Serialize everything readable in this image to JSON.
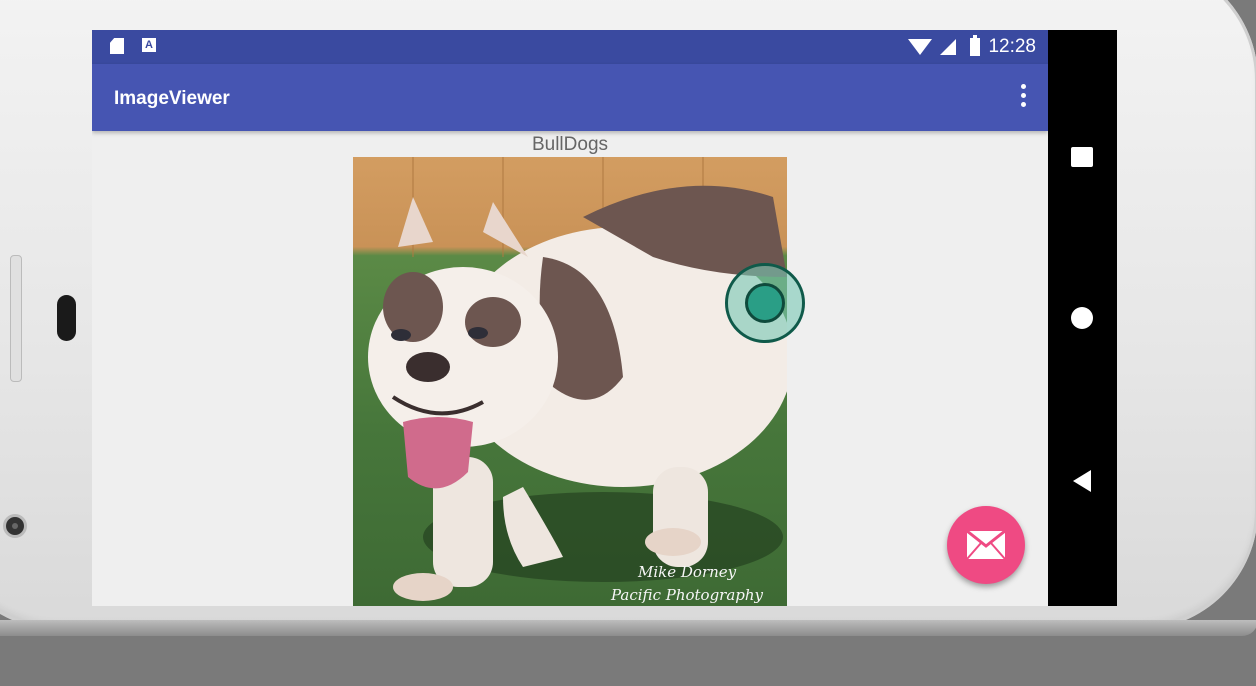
{
  "status_bar": {
    "time": "12:28"
  },
  "app_bar": {
    "title": "ImageViewer"
  },
  "content": {
    "title": "BullDogs",
    "photo_caption_line1": "Mike Dorney",
    "photo_caption_line2": "Pacific Photography"
  },
  "icons": {
    "status": [
      "sd-card-icon",
      "font-a-icon",
      "wifi-icon",
      "signal-icon",
      "battery-icon"
    ],
    "app_bar": [
      "overflow-menu-icon"
    ],
    "nav": [
      "recent-apps-icon",
      "home-icon",
      "back-icon"
    ],
    "fab": "mail-icon"
  },
  "colors": {
    "status_bar": "#3a4aa0",
    "app_bar": "#4655b2",
    "fab": "#ef4a83",
    "touch_indicator": "#2a9e86"
  }
}
